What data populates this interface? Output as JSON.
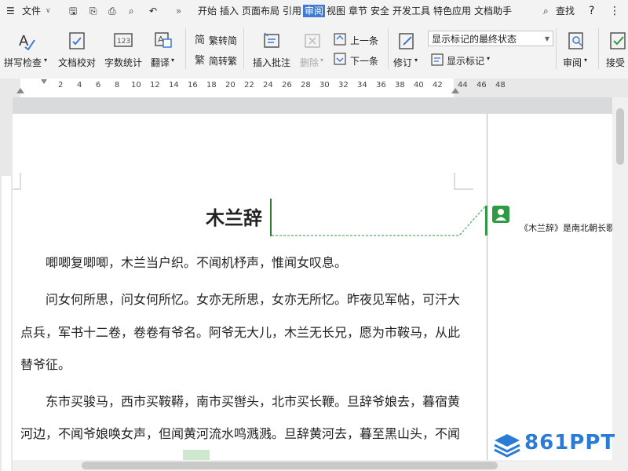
{
  "menubar": {
    "file_label": "文件",
    "tabs": [
      "开始",
      "插入",
      "页面布局",
      "引用",
      "审阅",
      "视图",
      "章节",
      "安全",
      "开发工具",
      "特色应用",
      "文档助手"
    ],
    "active_tab": "审阅",
    "search_label": "查找"
  },
  "ribbon": {
    "spell_check": "拼写检查",
    "doc_proof": "文档校对",
    "word_count": "字数统计",
    "translate": "翻译",
    "trad_to_simp": "繁转简",
    "simp_to_trad": "简转繁",
    "insert_comment": "插入批注",
    "delete": "删除",
    "prev": "上一条",
    "next": "下一条",
    "revise": "修订",
    "display_state": "显示标记的最终状态",
    "show_markup": "显示标记",
    "review": "审阅",
    "accept": "接受"
  },
  "ruler": {
    "numbers": [
      "2",
      "4",
      "6",
      "8",
      "10",
      "12",
      "14",
      "16",
      "18",
      "20",
      "22",
      "24",
      "26",
      "28",
      "30",
      "32",
      "34",
      "36",
      "38",
      "40",
      "42",
      "44",
      "46",
      "48"
    ]
  },
  "document": {
    "title": "木兰辞",
    "lines": [
      "唧唧复唧唧，木兰当户织。不闻机杼声，惟闻女叹息。",
      "问女何所思，问女何所忆。女亦无所思，女亦无所忆。昨夜见军帖，可汗大",
      "点兵，军书十二卷，卷卷有爷名。阿爷无大儿，木兰无长兄，愿为市鞍马，从此",
      "替爷征。",
      "东市买骏马，西市买鞍鞯，南市买辔头，北市买长鞭。旦辞爷娘去，暮宿黄",
      "河边，不闻爷娘唤女声，但闻黄河流水鸣溅溅。旦辞黄河去，暮至黑山头，不闻"
    ]
  },
  "comment": {
    "text": "《木兰辞》是南北朝长歌"
  },
  "watermark": {
    "text": "861PPT"
  },
  "colors": {
    "accent": "#3d7bd6",
    "comment_green": "#2e9a44",
    "logo_blue": "#2a7bd6"
  }
}
